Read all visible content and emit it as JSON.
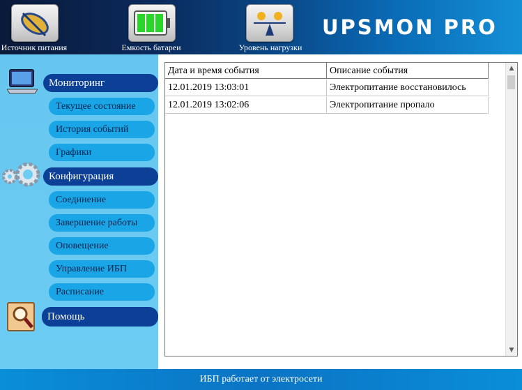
{
  "toolbar": {
    "power_source_label": "Источник питания",
    "battery_label": "Емкость батареи",
    "load_label": "Уровень нагрузки",
    "logo_text": "UPSMON PRO"
  },
  "sidebar": {
    "monitoring": {
      "label": "Мониторинг",
      "items": [
        "Текущее состояние",
        "История событий",
        "Графики"
      ]
    },
    "configuration": {
      "label": "Конфигурация",
      "items": [
        "Соединение",
        "Завершение работы",
        "Оповещение",
        "Управление ИБП",
        "Расписание"
      ]
    },
    "help": {
      "label": "Помощь"
    }
  },
  "events_table": {
    "columns": [
      "Дата и время события",
      "Описание события"
    ],
    "rows": [
      [
        "12.01.2019 13:03:01",
        "Электропитание восстановилось"
      ],
      [
        "12.01.2019 13:02:06",
        "Электропитание пропало"
      ]
    ]
  },
  "status_bar": {
    "text": "ИБП работает от электросети"
  },
  "colors": {
    "category_button": "#0c3f96",
    "subitem_button": "#1aa6e6",
    "sidebar_bg": "#6dccf2",
    "status_bar": "#0a8ed8"
  },
  "icons": [
    "power-source-icon",
    "battery-icon",
    "load-balance-icon",
    "laptop-icon",
    "gears-icon",
    "magnifier-icon"
  ]
}
